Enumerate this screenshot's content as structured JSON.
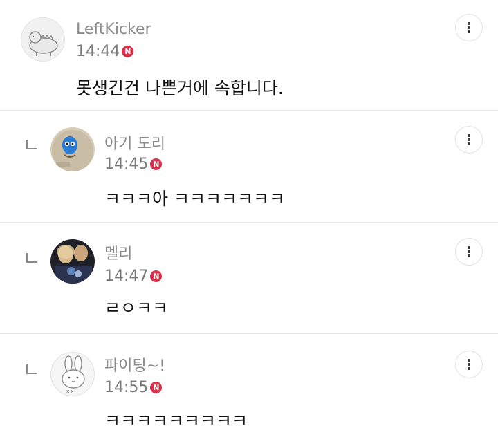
{
  "comments": [
    {
      "author": "LeftKicker",
      "time": "14:44",
      "badge": "N",
      "text": "못생긴건 나쁜거에 속합니다."
    },
    {
      "author": "아기 도리",
      "time": "14:45",
      "badge": "N",
      "text": "ㅋㅋㅋ아 ㅋㅋㅋㅋㅋㅋㅋ"
    },
    {
      "author": "멜리",
      "time": "14:47",
      "badge": "N",
      "text": "ㄹㅇㅋㅋ"
    },
    {
      "author": "파이팅~!",
      "time": "14:55",
      "badge": "N",
      "text": "ㅋㅋㅋㅋㅋㅋㅋㅋㅋ"
    }
  ],
  "icons": {
    "more": "more-vertical-icon",
    "reply": "reply-arrow-icon"
  },
  "colors": {
    "new_badge": "#d9304a",
    "author_text": "#8b8b8b",
    "time_text": "#7a7a7a",
    "divider": "#e6e6e6"
  }
}
